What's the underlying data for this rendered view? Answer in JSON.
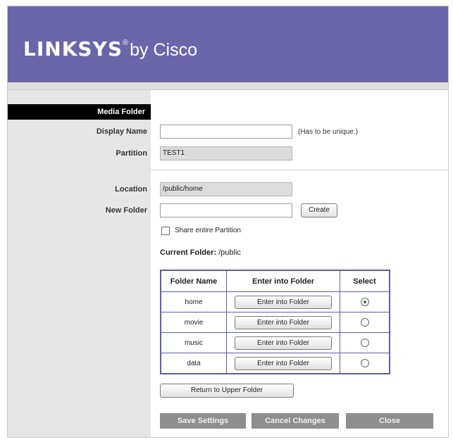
{
  "header": {
    "brand": "LINKSYS",
    "registered": "®",
    "by": "by Cisco"
  },
  "section": {
    "title": "Media Folder"
  },
  "form": {
    "display_name_label": "Display Name",
    "display_name_value": "",
    "display_name_hint": "(Has to be unique.)",
    "partition_label": "Partition",
    "partition_value": "TEST1",
    "location_label": "Location",
    "location_value": "/public/home",
    "new_folder_label": "New Folder",
    "new_folder_value": "",
    "create_label": "Create",
    "share_label": "Share entire Partition",
    "share_checked": false,
    "current_folder_label": "Current Folder:",
    "current_folder_value": "/public"
  },
  "table": {
    "headers": [
      "Folder Name",
      "Enter into Folder",
      "Select"
    ],
    "rows": [
      {
        "name": "home",
        "button": "Enter into Folder",
        "selected": true
      },
      {
        "name": "movie",
        "button": "Enter into Folder",
        "selected": false
      },
      {
        "name": "music",
        "button": "Enter into Folder",
        "selected": false
      },
      {
        "name": "data",
        "button": "Enter into Folder",
        "selected": false
      }
    ]
  },
  "actions": {
    "return_upper": "Return to Upper Folder",
    "save": "Save Settings",
    "cancel": "Cancel Changes",
    "close": "Close"
  },
  "colors": {
    "header_bg": "#6b65aa",
    "table_border": "#5a5fa8",
    "sidebar_bg": "#e6e6e6",
    "bottom_button_bg": "#8e8e8e"
  }
}
